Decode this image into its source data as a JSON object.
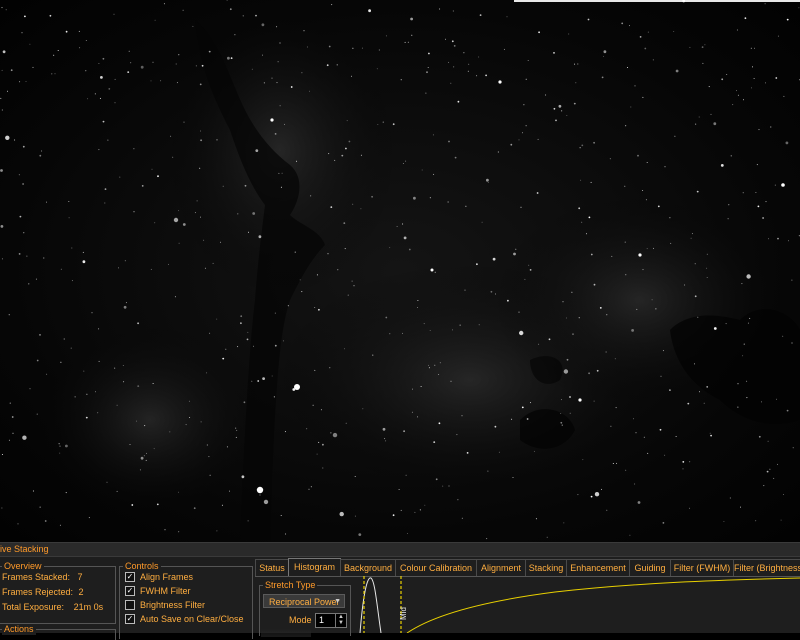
{
  "panel": {
    "title": "Live Stacking",
    "overview": {
      "label": "Overview",
      "frames_stacked_label": "Frames Stacked:",
      "frames_stacked": "7",
      "frames_rejected_label": "Frames Rejected:",
      "frames_rejected": "2",
      "total_exposure_label": "Total Exposure:",
      "total_exposure": "21m 0s"
    },
    "actions": {
      "label": "Actions"
    },
    "controls": {
      "label": "Controls",
      "items": [
        {
          "label": "Align Frames",
          "checked": true
        },
        {
          "label": "FWHM Filter",
          "checked": true
        },
        {
          "label": "Brightness Filter",
          "checked": false
        },
        {
          "label": "Auto Save on Clear/Close",
          "checked": true
        }
      ]
    },
    "tabs": [
      "Status",
      "Histogram",
      "Background",
      "Colour Calibration",
      "Alignment",
      "Stacking",
      "Enhancement",
      "Guiding",
      "Filter (FWHM)",
      "Filter (Brightness)"
    ],
    "active_tab": "Histogram",
    "histogram": {
      "stretch_type_label": "Stretch Type",
      "stretch_type_value": "Reciprocal Power",
      "mode_label": "Mode",
      "mode_value": "1",
      "curve_marker_label": "Mid"
    }
  },
  "colors": {
    "accent": "#ff9a2a",
    "curve": "#e8d000",
    "panel_bg": "#1e1e1e"
  }
}
